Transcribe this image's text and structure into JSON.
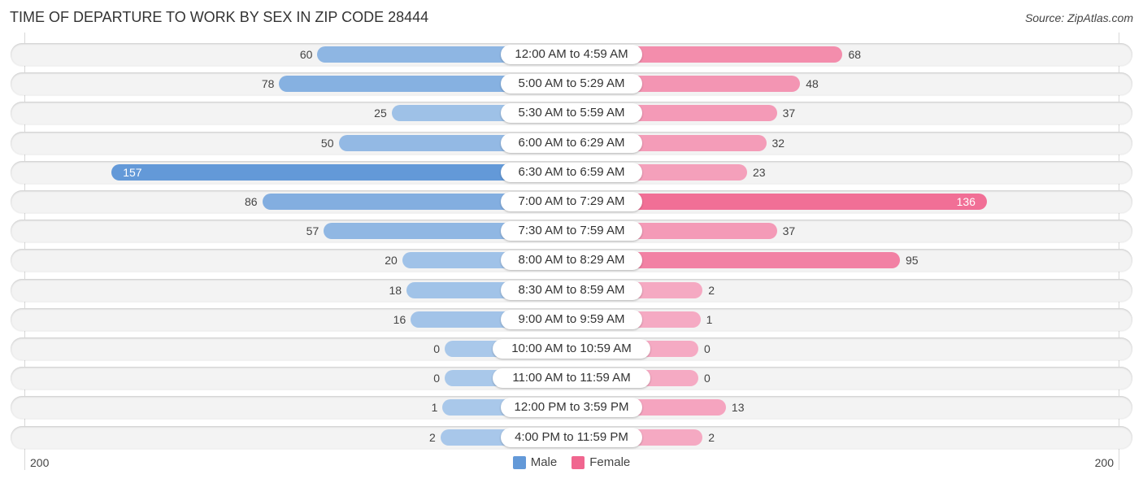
{
  "header": {
    "title": "TIME OF DEPARTURE TO WORK BY SEX IN ZIP CODE 28444",
    "source": "Source: ZipAtlas.com"
  },
  "colors": {
    "male_strong": "#6399d8",
    "male_light": "#a9c8ea",
    "female_strong": "#f0668f",
    "female_light": "#f5aac3"
  },
  "chart_data": {
    "type": "bar",
    "orientation": "horizontal-diverging",
    "title": "TIME OF DEPARTURE TO WORK BY SEX IN ZIP CODE 28444",
    "categories": [
      "12:00 AM to 4:59 AM",
      "5:00 AM to 5:29 AM",
      "5:30 AM to 5:59 AM",
      "6:00 AM to 6:29 AM",
      "6:30 AM to 6:59 AM",
      "7:00 AM to 7:29 AM",
      "7:30 AM to 7:59 AM",
      "8:00 AM to 8:29 AM",
      "8:30 AM to 8:59 AM",
      "9:00 AM to 9:59 AM",
      "10:00 AM to 10:59 AM",
      "11:00 AM to 11:59 AM",
      "12:00 PM to 3:59 PM",
      "4:00 PM to 11:59 PM"
    ],
    "series": [
      {
        "name": "Male",
        "values": [
          60,
          78,
          25,
          50,
          157,
          86,
          57,
          20,
          18,
          16,
          0,
          0,
          1,
          2
        ]
      },
      {
        "name": "Female",
        "values": [
          68,
          48,
          37,
          32,
          23,
          136,
          37,
          95,
          2,
          1,
          0,
          0,
          13,
          2
        ]
      }
    ],
    "axis": {
      "left_tick": "200",
      "right_tick": "200",
      "max": 200
    },
    "legend": {
      "position": "bottom-center",
      "entries": [
        "Male",
        "Female"
      ]
    },
    "grid": false
  }
}
